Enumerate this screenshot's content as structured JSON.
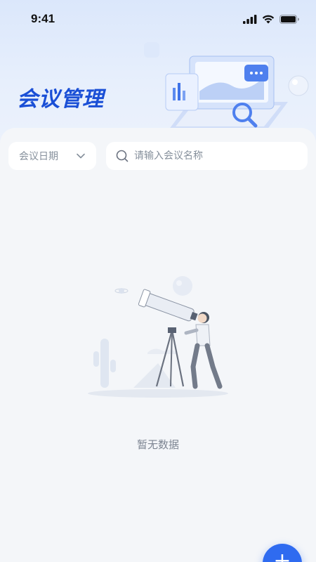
{
  "status_bar": {
    "time": "9:41"
  },
  "header": {
    "title": "会议管理"
  },
  "filters": {
    "date_label": "会议日期",
    "search_placeholder": "请输入会议名称"
  },
  "empty_state": {
    "text": "暂无数据"
  },
  "fab": {
    "label": "+"
  },
  "colors": {
    "accent": "#2f6bf0",
    "title": "#1a4fd6",
    "background": "#f4f6f9"
  },
  "icons": [
    "signal-icon",
    "wifi-icon",
    "battery-icon",
    "chevron-down-icon",
    "search-icon",
    "plus-icon"
  ]
}
